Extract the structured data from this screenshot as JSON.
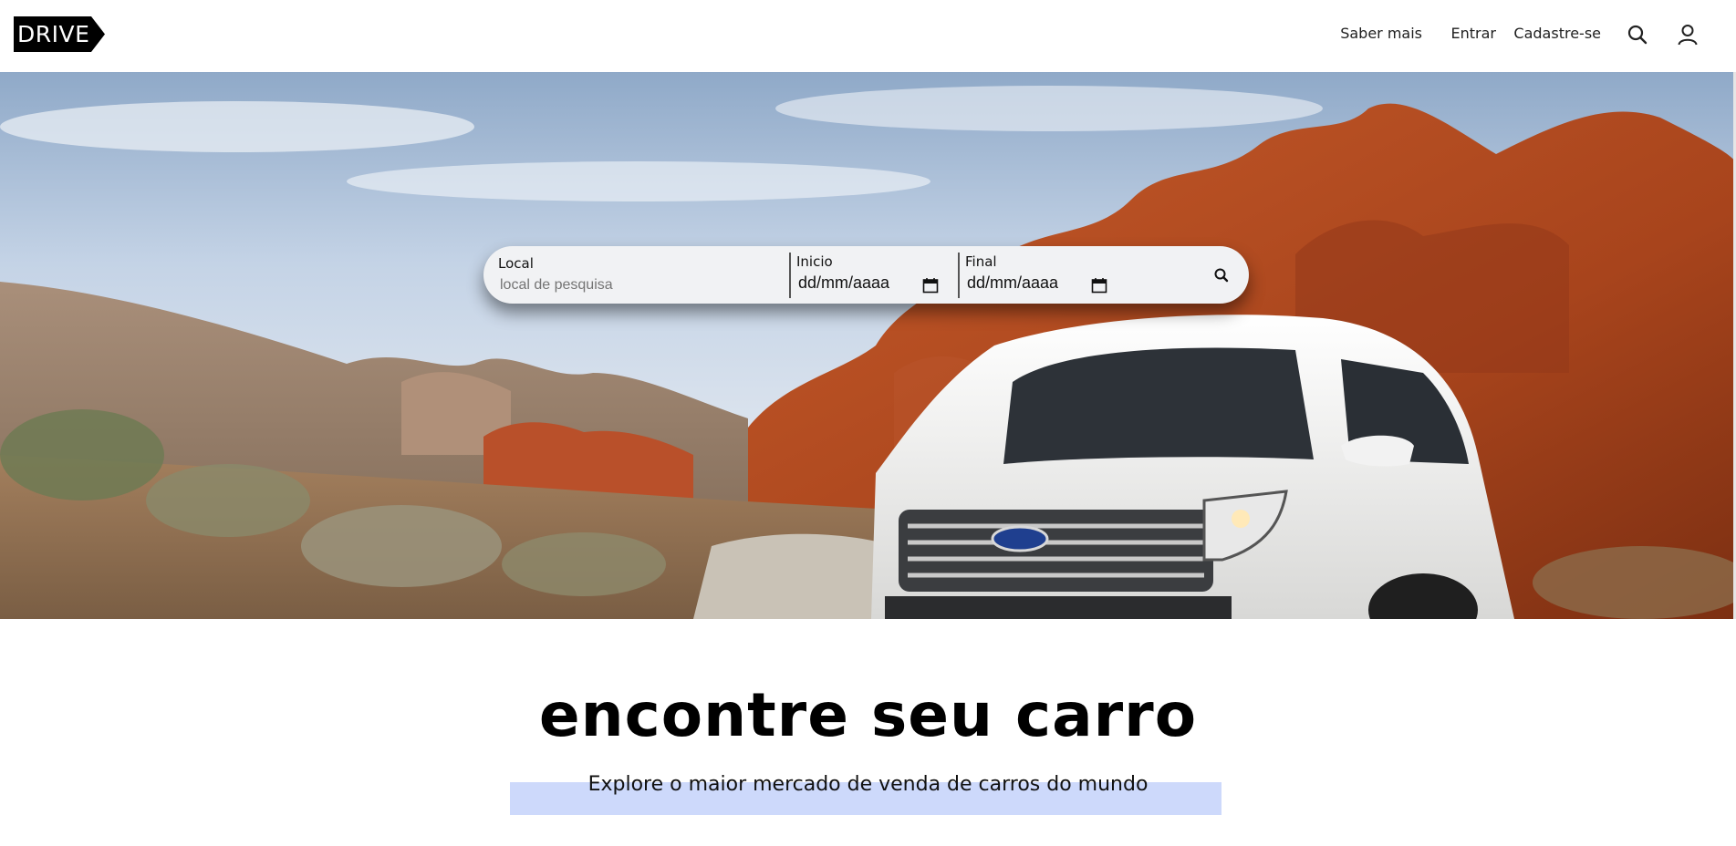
{
  "header": {
    "logo_text": "DRIVE",
    "nav": {
      "learn_more": "Saber mais",
      "login": "Entrar",
      "signup": "Cadastre-se"
    },
    "icons": {
      "search": "search-icon",
      "user": "user-icon"
    }
  },
  "search": {
    "location_label": "Local",
    "location_placeholder": "local de pesquisa",
    "start_label": "Inicio",
    "start_value": "dd/mm/aaaa",
    "end_label": "Final",
    "end_value": "dd/mm/aaaa",
    "submit_icon": "search-icon"
  },
  "main": {
    "title": "encontre seu carro",
    "subtitle": "Explore o maior mercado de venda de carros do mundo"
  },
  "colors": {
    "logo_bg": "#000000",
    "search_bg": "#f1f2f4",
    "highlight": "#cdd9fb",
    "sky": "#c9d8ea",
    "rock": "#b24a22"
  }
}
